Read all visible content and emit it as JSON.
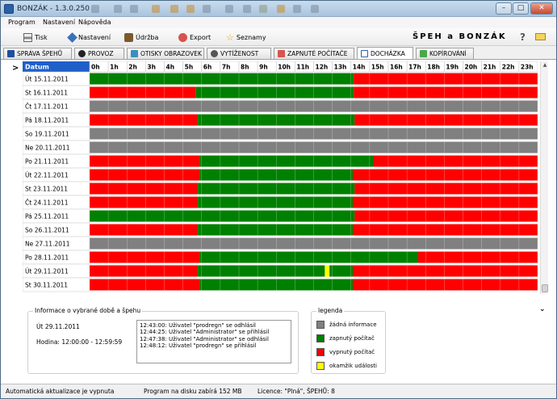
{
  "window": {
    "title": "BONZÁK - 1.3.0.250"
  },
  "menu": [
    "Program",
    "Nastavení",
    "Nápověda"
  ],
  "toolbar": {
    "print": "Tisk",
    "settings": "Nastavení",
    "maintenance": "Údržba",
    "export": "Export",
    "lists": "Seznamy",
    "brand": "ŠPEH a BONZÁK",
    "help": "?"
  },
  "tabs": [
    "SPRÁVA ŠPEHŮ",
    "PROVOZ",
    "OTISKY OBRAZOVEK",
    "VYTÍŽENOST",
    "ZAPNUTÉ POČÍTAČE",
    "DOCHÁZKA",
    "KOPÍROVÁNÍ"
  ],
  "active_tab": "DOCHÁZKA",
  "grid": {
    "header_label": "Datum",
    "hours": [
      "0h",
      "1h",
      "2h",
      "3h",
      "4h",
      "5h",
      "6h",
      "7h",
      "8h",
      "9h",
      "10h",
      "11h",
      "12h",
      "13h",
      "14h",
      "15h",
      "16h",
      "17h",
      "18h",
      "19h",
      "20h",
      "21h",
      "22h",
      "23h"
    ],
    "colors": {
      "none": "#808080",
      "on": "#008000",
      "off": "#ff0000",
      "event": "#ffff00"
    },
    "rows": [
      {
        "date": "Út  15.11.2011",
        "segments": [
          [
            "on",
            0,
            14.15
          ],
          [
            "off",
            14.15,
            24
          ]
        ]
      },
      {
        "date": "St  16.11.2011",
        "segments": [
          [
            "off",
            0,
            5.7
          ],
          [
            "on",
            5.7,
            14.15
          ],
          [
            "off",
            14.15,
            24
          ]
        ]
      },
      {
        "date": "Čt  17.11.2011",
        "segments": [
          [
            "none",
            0,
            24
          ]
        ]
      },
      {
        "date": "Pá  18.11.2011",
        "segments": [
          [
            "off",
            0,
            5.8
          ],
          [
            "on",
            5.8,
            14.2
          ],
          [
            "off",
            14.2,
            24
          ]
        ]
      },
      {
        "date": "So  19.11.2011",
        "segments": [
          [
            "none",
            0,
            24
          ]
        ]
      },
      {
        "date": "Ne  20.11.2011",
        "segments": [
          [
            "none",
            0,
            24
          ]
        ]
      },
      {
        "date": "Po  21.11.2011",
        "segments": [
          [
            "off",
            0,
            5.9
          ],
          [
            "on",
            5.9,
            15.2
          ],
          [
            "off",
            15.2,
            24
          ]
        ]
      },
      {
        "date": "Út  22.11.2011",
        "segments": [
          [
            "off",
            0,
            5.9
          ],
          [
            "on",
            5.9,
            14.1
          ],
          [
            "off",
            14.1,
            24
          ]
        ]
      },
      {
        "date": "St  23.11.2011",
        "segments": [
          [
            "off",
            0,
            5.8
          ],
          [
            "on",
            5.8,
            14.2
          ],
          [
            "off",
            14.2,
            24
          ]
        ]
      },
      {
        "date": "Čt  24.11.2011",
        "segments": [
          [
            "off",
            0,
            5.8
          ],
          [
            "on",
            5.8,
            14.1
          ],
          [
            "off",
            14.1,
            24
          ]
        ]
      },
      {
        "date": "Pá  25.11.2011",
        "segments": [
          [
            "on",
            0,
            14.2
          ],
          [
            "off",
            14.2,
            24
          ]
        ]
      },
      {
        "date": "So  26.11.2011",
        "segments": [
          [
            "off",
            0,
            5.8
          ],
          [
            "on",
            5.8,
            14.1
          ],
          [
            "off",
            14.1,
            24
          ]
        ]
      },
      {
        "date": "Ne  27.11.2011",
        "segments": [
          [
            "none",
            0,
            24
          ]
        ]
      },
      {
        "date": "Po  28.11.2011",
        "segments": [
          [
            "off",
            0,
            5.9
          ],
          [
            "on",
            5.9,
            17.6
          ],
          [
            "off",
            17.6,
            24
          ]
        ]
      },
      {
        "date": "Út  29.11.2011",
        "segments": [
          [
            "off",
            0,
            5.8
          ],
          [
            "on",
            5.8,
            12.6
          ],
          [
            "event",
            12.6,
            12.85
          ],
          [
            "on",
            12.85,
            14.1
          ],
          [
            "off",
            14.1,
            24
          ]
        ]
      },
      {
        "date": "St  30.11.2011",
        "segments": [
          [
            "off",
            0,
            5.9
          ],
          [
            "on",
            5.9,
            14.1
          ],
          [
            "off",
            14.1,
            24
          ]
        ]
      }
    ]
  },
  "info": {
    "title": "Informace o vybrané době a špehu",
    "date": "Út  29.11.2011",
    "time": "Hodina: 12:00:00 - 12:59:59",
    "events": [
      "12:43:00: Uživatel \"prodregn\" se odhlásil",
      "12:44:25: Uživatel \"Administrator\" se přihlásil",
      "12:47:38: Uživatel \"Administrator\" se odhlásil",
      "12:48:12: Uživatel \"prodregn\" se přihlásil"
    ]
  },
  "legend": {
    "title": "legenda",
    "items": [
      {
        "label": "žádná informace",
        "color": "#808080"
      },
      {
        "label": "zapnutý počítač",
        "color": "#008000"
      },
      {
        "label": "vypnutý počítač",
        "color": "#ff0000"
      },
      {
        "label": "okamžik události",
        "color": "#ffff00"
      }
    ]
  },
  "status": {
    "update": "Automatická aktualizace je vypnuta",
    "disk": "Program na disku zabírá 152 MB",
    "license": "Licence: \"Plná\", ŠPEHŮ: 8"
  }
}
